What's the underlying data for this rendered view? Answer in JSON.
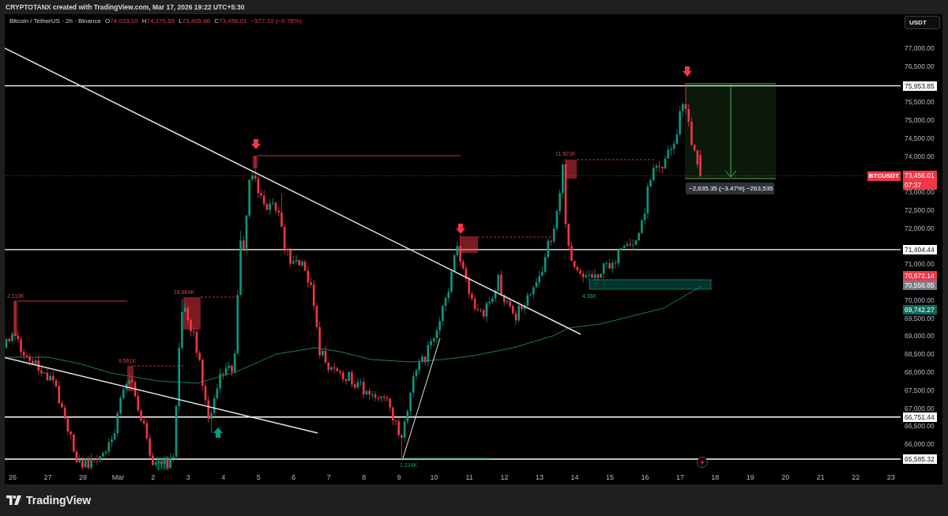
{
  "header": {
    "caption": "CRYPTOTANX created with TradingView.com, Mar 17, 2026 19:22 UTC+5:30"
  },
  "legend": {
    "symbol": "Bitcoin / TetherUS · 2h · Binance",
    "values": [
      {
        "label": "O",
        "value": "74,033.10"
      },
      {
        "label": "H",
        "value": "74,170.55"
      },
      {
        "label": "L",
        "value": "73,405.86"
      },
      {
        "label": "C",
        "value": "73,456.01"
      }
    ],
    "change": "−577.10 (−0.78%)"
  },
  "currency_button": {
    "label": "USDT"
  },
  "price_axis": {
    "ticks": [
      "77,000.00",
      "76,500.00",
      "75,500.00",
      "75,000.00",
      "74,500.00",
      "74,000.00",
      "73,000.00",
      "72,500.00",
      "72,000.00",
      "71,000.00",
      "70,000.00",
      "69,500.00",
      "69,000.00",
      "68,500.00",
      "68,000.00",
      "67,500.00",
      "67,000.00",
      "66,500.00",
      "66,000.00"
    ],
    "tags": [
      {
        "value": "75,953.85",
        "kind": "level",
        "color": "#ffffff"
      },
      {
        "value": "73,456.01",
        "countdown": "07:37",
        "symbol": "BTCUSDT",
        "kind": "last_price",
        "color": "#f23645"
      },
      {
        "value": "71,404.44",
        "kind": "level",
        "color": "#ffffff"
      },
      {
        "value": "70,672.14",
        "kind": "marker",
        "color": "#f23645"
      },
      {
        "value": "70,556.85",
        "kind": "marker",
        "color": "#787b86"
      },
      {
        "value": "69,742.27",
        "kind": "marker",
        "color": "#0b6b59"
      },
      {
        "value": "66,751.44",
        "kind": "level",
        "color": "#ffffff"
      },
      {
        "value": "65,585.32",
        "kind": "level",
        "color": "#ffffff"
      }
    ]
  },
  "zones": [
    {
      "kind": "supply",
      "label": "2.113K"
    },
    {
      "kind": "supply",
      "label": "9.561K"
    },
    {
      "kind": "supply",
      "label": "18.664K"
    },
    {
      "kind": "supply"
    },
    {
      "kind": "supply"
    },
    {
      "kind": "supply",
      "label": "11.523K"
    },
    {
      "kind": "demand"
    },
    {
      "kind": "demand",
      "label": "4.36K"
    },
    {
      "kind": "demand",
      "label": "1.224K"
    }
  ],
  "measure": {
    "label": "−2,635.35 (−3.47%) −263,535"
  },
  "time_axis": {
    "labels": [
      "26",
      "27",
      "28",
      "Mar",
      "2",
      "3",
      "4",
      "5",
      "6",
      "7",
      "8",
      "9",
      "10",
      "11",
      "12",
      "13",
      "14",
      "15",
      "16",
      "17",
      "18",
      "19",
      "20",
      "21",
      "22",
      "23"
    ]
  },
  "footer": {
    "brand": "TradingView"
  }
}
